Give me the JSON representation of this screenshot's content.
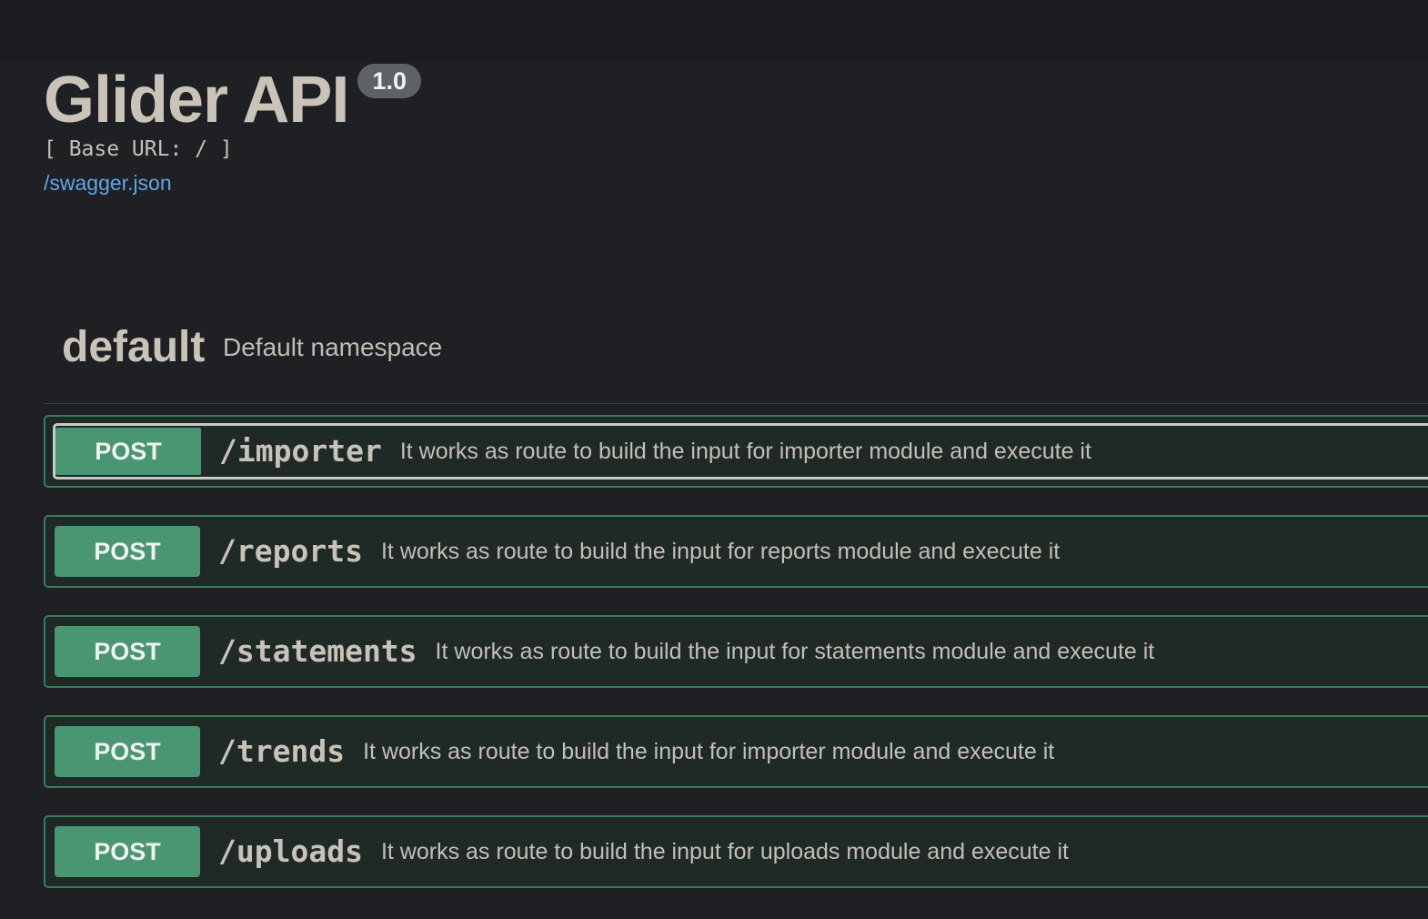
{
  "info": {
    "title": "Glider API",
    "version": "1.0",
    "base_url_text": "[ Base URL: / ]",
    "spec_link": "/swagger.json"
  },
  "tag": {
    "name": "default",
    "description": "Default namespace"
  },
  "operations": [
    {
      "method": "POST",
      "path": "/importer",
      "summary": "It works as route to build the input for importer module and execute it"
    },
    {
      "method": "POST",
      "path": "/reports",
      "summary": "It works as route to build the input for reports module and execute it"
    },
    {
      "method": "POST",
      "path": "/statements",
      "summary": "It works as route to build the input for statements module and execute it"
    },
    {
      "method": "POST",
      "path": "/trends",
      "summary": "It works as route to build the input for importer module and execute it"
    },
    {
      "method": "POST",
      "path": "/uploads",
      "summary": "It works as route to build the input for uploads module and execute it"
    }
  ],
  "colors": {
    "post_method": "#4a9572",
    "post_border": "#3c7a5c",
    "link": "#63a4e6",
    "background": "#1e2023"
  }
}
